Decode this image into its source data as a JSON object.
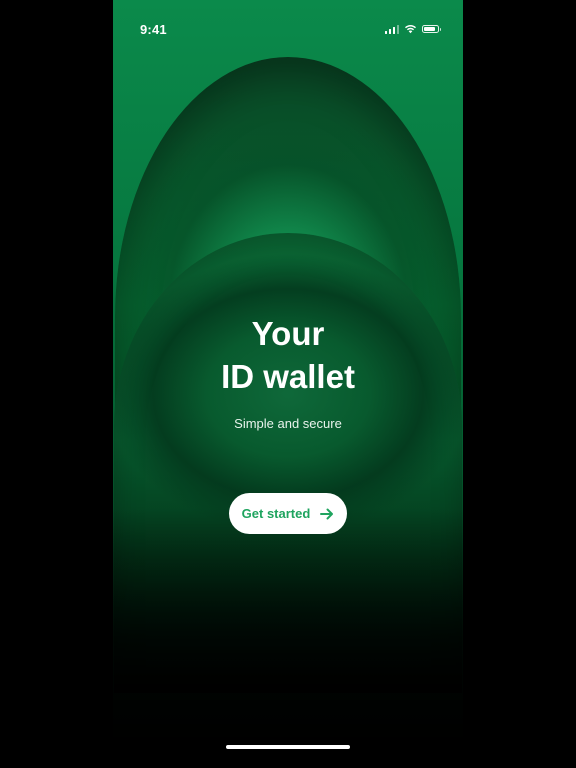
{
  "status_bar": {
    "time": "9:41",
    "signal_bars": 4,
    "battery_level_fraction": 0.85
  },
  "hero": {
    "title_line1": "Your",
    "title_line2": "ID wallet",
    "subtitle": "Simple and secure"
  },
  "cta": {
    "label": "Get started",
    "icon": "arrow-right-icon"
  },
  "colors": {
    "brand_green": "#0b8a4b",
    "accent_text": "#1fa45f",
    "background": "#000000"
  }
}
